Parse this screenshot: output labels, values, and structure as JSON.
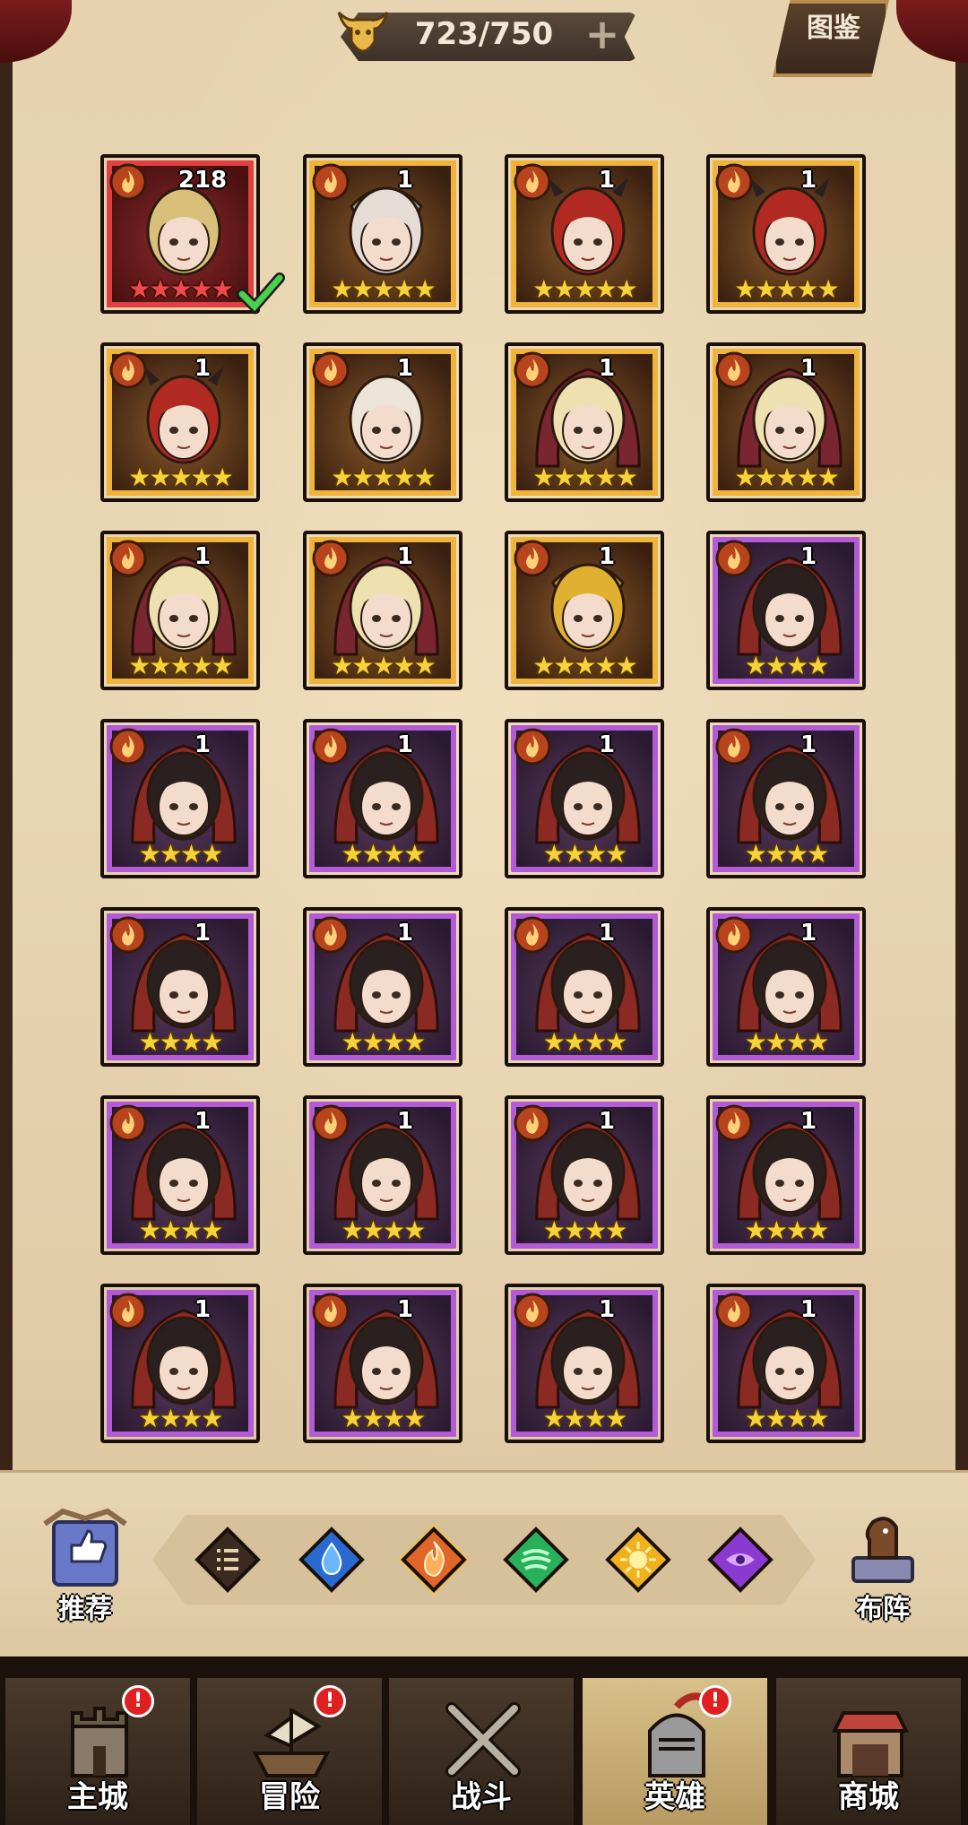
{
  "header": {
    "counter_value": "723/750",
    "plus_glyph": "+",
    "codex_label": "图鉴"
  },
  "heroes": [
    {
      "level": "218",
      "rarity": "red",
      "stars": 5,
      "portrait": "blonde-green-eyed",
      "element": "fire",
      "selected": true
    },
    {
      "level": "1",
      "rarity": "gold",
      "stars": 5,
      "portrait": "white-haired-helmet",
      "element": "fire"
    },
    {
      "level": "1",
      "rarity": "gold",
      "stars": 5,
      "portrait": "red-haired-horned",
      "element": "fire"
    },
    {
      "level": "1",
      "rarity": "gold",
      "stars": 5,
      "portrait": "red-haired-horned",
      "element": "fire"
    },
    {
      "level": "1",
      "rarity": "gold",
      "stars": 5,
      "portrait": "red-haired-horned",
      "element": "fire"
    },
    {
      "level": "1",
      "rarity": "gold",
      "stars": 5,
      "portrait": "white-haired-wild",
      "element": "fire"
    },
    {
      "level": "1",
      "rarity": "gold",
      "stars": 5,
      "portrait": "blonde-bob-hood",
      "element": "fire"
    },
    {
      "level": "1",
      "rarity": "gold",
      "stars": 5,
      "portrait": "blonde-bob-hood",
      "element": "fire"
    },
    {
      "level": "1",
      "rarity": "gold",
      "stars": 5,
      "portrait": "blonde-bob-hood",
      "element": "fire"
    },
    {
      "level": "1",
      "rarity": "gold",
      "stars": 5,
      "portrait": "blonde-bob-hood",
      "element": "fire"
    },
    {
      "level": "1",
      "rarity": "gold",
      "stars": 5,
      "portrait": "gold-helmet-knight",
      "element": "fire"
    },
    {
      "level": "1",
      "rarity": "purple",
      "stars": 4,
      "portrait": "hooded-dark-haired",
      "element": "fire"
    },
    {
      "level": "1",
      "rarity": "purple",
      "stars": 4,
      "portrait": "hooded-dark-haired",
      "element": "fire"
    },
    {
      "level": "1",
      "rarity": "purple",
      "stars": 4,
      "portrait": "hooded-dark-haired",
      "element": "fire"
    },
    {
      "level": "1",
      "rarity": "purple",
      "stars": 4,
      "portrait": "hooded-dark-haired",
      "element": "fire"
    },
    {
      "level": "1",
      "rarity": "purple",
      "stars": 4,
      "portrait": "hooded-dark-haired",
      "element": "fire"
    },
    {
      "level": "1",
      "rarity": "purple",
      "stars": 4,
      "portrait": "hooded-dark-haired",
      "element": "fire"
    },
    {
      "level": "1",
      "rarity": "purple",
      "stars": 4,
      "portrait": "hooded-dark-haired",
      "element": "fire"
    },
    {
      "level": "1",
      "rarity": "purple",
      "stars": 4,
      "portrait": "hooded-dark-haired",
      "element": "fire"
    },
    {
      "level": "1",
      "rarity": "purple",
      "stars": 4,
      "portrait": "hooded-dark-haired",
      "element": "fire"
    },
    {
      "level": "1",
      "rarity": "purple",
      "stars": 4,
      "portrait": "hooded-dark-haired",
      "element": "fire"
    },
    {
      "level": "1",
      "rarity": "purple",
      "stars": 4,
      "portrait": "hooded-dark-haired",
      "element": "fire"
    },
    {
      "level": "1",
      "rarity": "purple",
      "stars": 4,
      "portrait": "hooded-dark-haired",
      "element": "fire"
    },
    {
      "level": "1",
      "rarity": "purple",
      "stars": 4,
      "portrait": "hooded-dark-haired",
      "element": "fire"
    },
    {
      "level": "1",
      "rarity": "purple",
      "stars": 4,
      "portrait": "hooded-dark-haired",
      "element": "fire"
    },
    {
      "level": "1",
      "rarity": "purple",
      "stars": 4,
      "portrait": "hooded-dark-haired",
      "element": "fire"
    },
    {
      "level": "1",
      "rarity": "purple",
      "stars": 4,
      "portrait": "hooded-dark-haired",
      "element": "fire"
    },
    {
      "level": "1",
      "rarity": "purple",
      "stars": 4,
      "portrait": "hooded-dark-haired",
      "element": "fire"
    }
  ],
  "filters": [
    {
      "name": "all",
      "icon": "list-icon",
      "color": "#3a2a20",
      "active": false
    },
    {
      "name": "water",
      "icon": "water-drop-icon",
      "color": "#2a6ad0",
      "active": false
    },
    {
      "name": "fire",
      "icon": "fire-icon",
      "color": "#e0662a",
      "active": true
    },
    {
      "name": "wind",
      "icon": "wind-icon",
      "color": "#28b05a",
      "active": false
    },
    {
      "name": "light",
      "icon": "sun-icon",
      "color": "#f0b020",
      "active": false
    },
    {
      "name": "dark",
      "icon": "dark-eye-icon",
      "color": "#8a3ad0",
      "active": false
    }
  ],
  "side": {
    "recommend_label": "推荐",
    "formation_label": "布阵"
  },
  "nav": [
    {
      "label": "主城",
      "icon": "castle-icon",
      "badge": "!",
      "active": false
    },
    {
      "label": "冒险",
      "icon": "ship-icon",
      "badge": "!",
      "active": false
    },
    {
      "label": "战斗",
      "icon": "crossed-swords-icon",
      "badge": "",
      "active": false
    },
    {
      "label": "英雄",
      "icon": "knight-helmet-icon",
      "badge": "!",
      "active": true
    },
    {
      "label": "商城",
      "icon": "shop-icon",
      "badge": "",
      "active": false
    }
  ],
  "colors": {
    "gold_frame": "#f0b43a",
    "purple_frame": "#b35ad6",
    "red_frame": "#e04040",
    "star": "#f7d23a",
    "parchment": "#e6d2ae"
  }
}
